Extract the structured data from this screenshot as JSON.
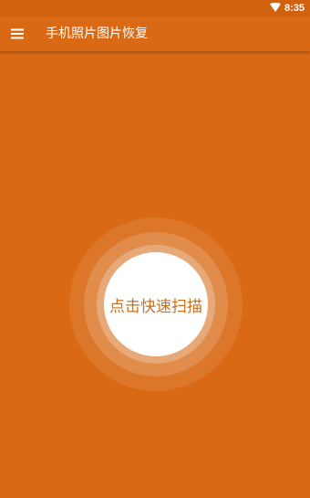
{
  "status_bar": {
    "time": "8:35",
    "wifi_icon": "wifi-icon"
  },
  "app_bar": {
    "menu_icon": "menu-icon",
    "title": "手机照片图片恢复"
  },
  "scan": {
    "label": "点击快速扫描"
  },
  "colors": {
    "primary": "#d96914",
    "status_bar": "#d0620f",
    "scan_text": "#c9701f",
    "white": "#ffffff"
  }
}
